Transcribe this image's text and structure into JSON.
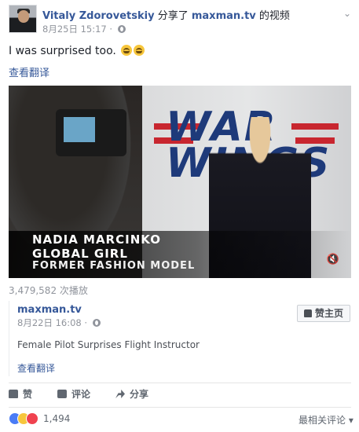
{
  "post": {
    "author": "Vitaly Zdorovetskiy",
    "shared_text": "分享了",
    "page": "maxman.tv",
    "possessive_video": "的视频",
    "date": "8月25日 15:17",
    "separator": "·",
    "privacy_icon": "globe-icon",
    "menu_icon": "chevron-down-icon",
    "text": "I was surprised too.",
    "emojis": [
      "laughing-crying-emoji",
      "laughing-crying-emoji"
    ],
    "translate": "查看翻译"
  },
  "video": {
    "backdrop_text": "WAR WINGS",
    "caption_line1": "NADIA MARCINKO",
    "caption_line2": "GLOBAL GIRL",
    "caption_line3": "FORMER FASHION MODEL",
    "mute_icon": "speaker-muted-icon",
    "views": "3,479,582 次播放"
  },
  "shared_post": {
    "page": "maxman.tv",
    "date": "8月22日 16:08",
    "separator": "·",
    "privacy_icon": "globe-icon",
    "like_page_label": "赞主页",
    "description": "Female Pilot Surprises Flight Instructor",
    "translate": "查看翻译"
  },
  "actions": {
    "like": "赞",
    "comment": "评论",
    "share": "分享"
  },
  "footer": {
    "reaction_icons": [
      "like-reaction",
      "haha-reaction",
      "love-reaction"
    ],
    "reaction_count": "1,494",
    "sort_label": "最相关评论",
    "sort_caret": "▾"
  },
  "colors": {
    "link": "#365899",
    "muted": "#90949c",
    "like_reaction": "#4a7cf6",
    "love_reaction": "#f0424f",
    "haha_reaction": "#f7c63c"
  }
}
